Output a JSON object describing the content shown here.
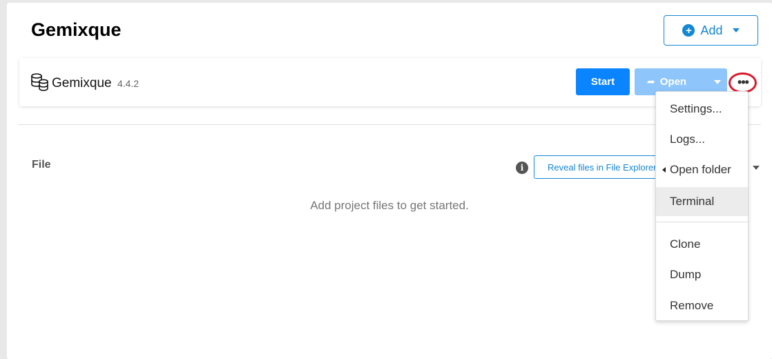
{
  "header": {
    "title": "Gemixque",
    "add_label": "Add"
  },
  "database": {
    "name": "Gemixque",
    "version": "4.4.2",
    "icon": "database-icon",
    "start_label": "Start",
    "open_label": "Open",
    "more_label": "•••"
  },
  "files": {
    "section_label": "File",
    "reveal_label": "Reveal files in File Explorer",
    "empty_message": "Add project files to get started."
  },
  "menu": {
    "items": [
      {
        "label": "Settings..."
      },
      {
        "label": "Logs..."
      },
      {
        "label": "Open folder"
      },
      {
        "label": "Terminal"
      },
      {
        "label": "Clone"
      },
      {
        "label": "Dump"
      },
      {
        "label": "Remove"
      }
    ]
  },
  "colors": {
    "accent": "#0a84ff",
    "accent_disabled": "#8ec5fb",
    "highlight": "#d71a2b"
  }
}
